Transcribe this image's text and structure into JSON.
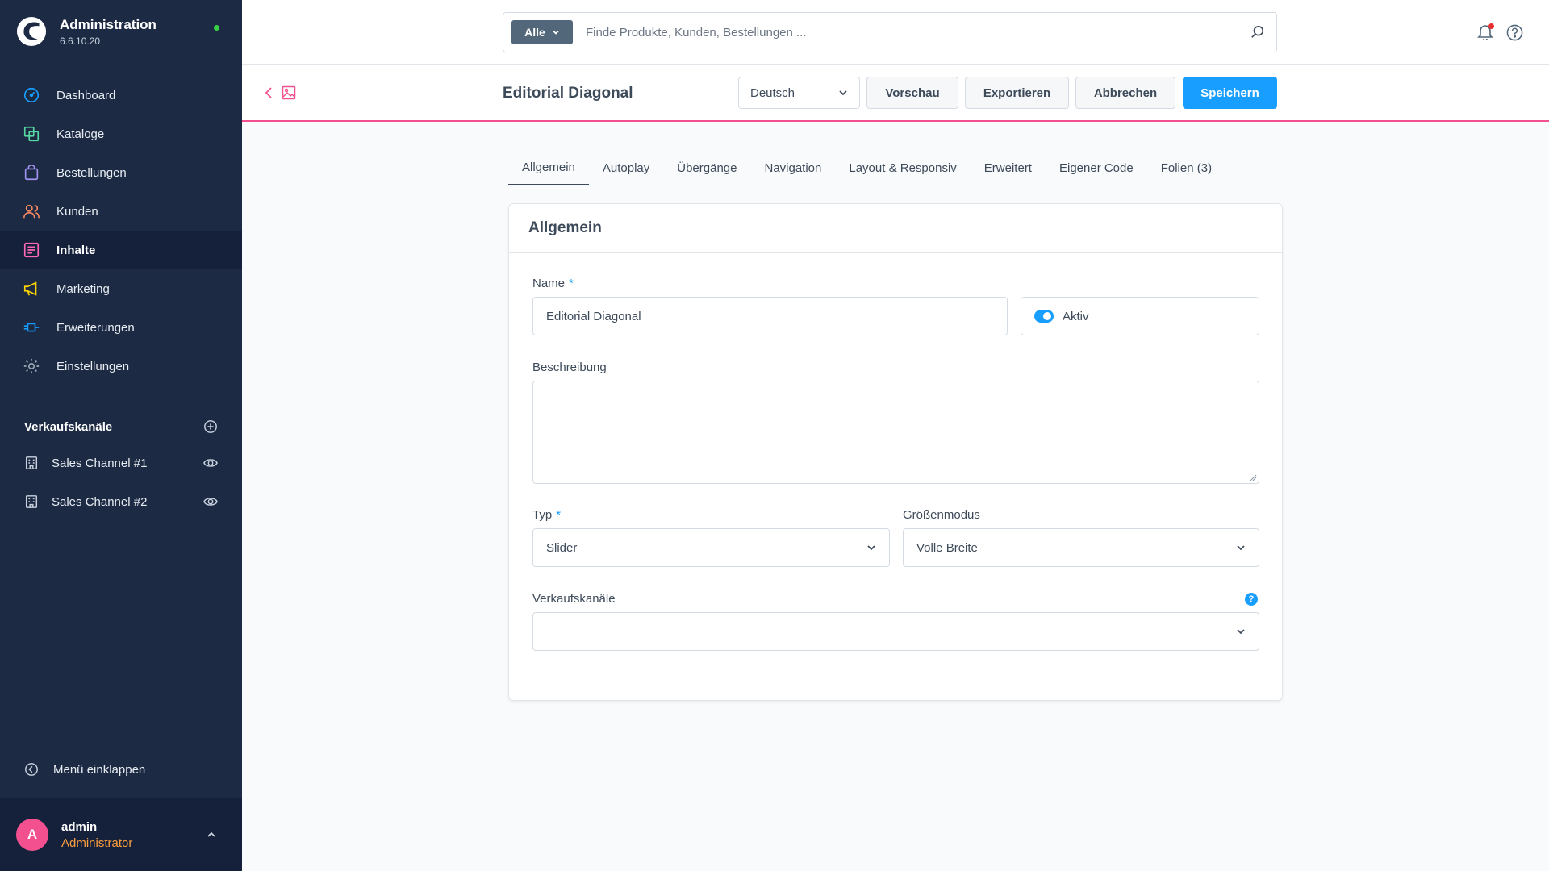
{
  "app": {
    "title": "Administration",
    "version": "6.6.10.20"
  },
  "nav": {
    "items": [
      {
        "label": "Dashboard",
        "icon": "dashboard-icon",
        "color": "#189eff"
      },
      {
        "label": "Kataloge",
        "icon": "catalog-icon",
        "color": "#57d9a3"
      },
      {
        "label": "Bestellungen",
        "icon": "shopping-bag-icon",
        "color": "#a092f0"
      },
      {
        "label": "Kunden",
        "icon": "users-icon",
        "color": "#f88962"
      },
      {
        "label": "Inhalte",
        "icon": "content-icon",
        "color": "#ff68b4",
        "active": true
      },
      {
        "label": "Marketing",
        "icon": "megaphone-icon",
        "color": "#ffd700"
      },
      {
        "label": "Erweiterungen",
        "icon": "plug-icon",
        "color": "#189eff"
      },
      {
        "label": "Einstellungen",
        "icon": "gear-icon",
        "color": "#9aa8b5"
      }
    ]
  },
  "sales_channels": {
    "title": "Verkaufskanäle",
    "items": [
      {
        "label": "Sales Channel #1"
      },
      {
        "label": "Sales Channel #2"
      }
    ]
  },
  "sidebar_footer": {
    "collapse_label": "Menü einklappen",
    "user_initial": "A",
    "user_name": "admin",
    "user_role": "Administrator"
  },
  "search": {
    "type_label": "Alle",
    "placeholder": "Finde Produkte, Kunden, Bestellungen ..."
  },
  "smartbar": {
    "title": "Editorial Diagonal",
    "language": "Deutsch",
    "preview_label": "Vorschau",
    "export_label": "Exportieren",
    "cancel_label": "Abbrechen",
    "save_label": "Speichern"
  },
  "tabs": [
    {
      "label": "Allgemein",
      "active": true
    },
    {
      "label": "Autoplay"
    },
    {
      "label": "Übergänge"
    },
    {
      "label": "Navigation"
    },
    {
      "label": "Layout & Responsiv"
    },
    {
      "label": "Erweitert"
    },
    {
      "label": "Eigener Code"
    },
    {
      "label": "Folien (3)"
    }
  ],
  "form": {
    "card_title": "Allgemein",
    "name_label": "Name",
    "required_marker": "*",
    "name_value": "Editorial Diagonal",
    "active_label": "Aktiv",
    "active": true,
    "description_label": "Beschreibung",
    "description_value": "",
    "type_label": "Typ",
    "type_value": "Slider",
    "size_mode_label": "Größenmodus",
    "size_mode_value": "Volle Breite",
    "sales_channels_label": "Verkaufskanäle",
    "sales_channels_value": "",
    "help_glyph": "?"
  },
  "colors": {
    "sidebar_bg": "#1d2a44",
    "accent": "#189eff",
    "brand_pink": "#f2508e",
    "role_orange": "#ff9f40",
    "status_green": "#37d046"
  }
}
